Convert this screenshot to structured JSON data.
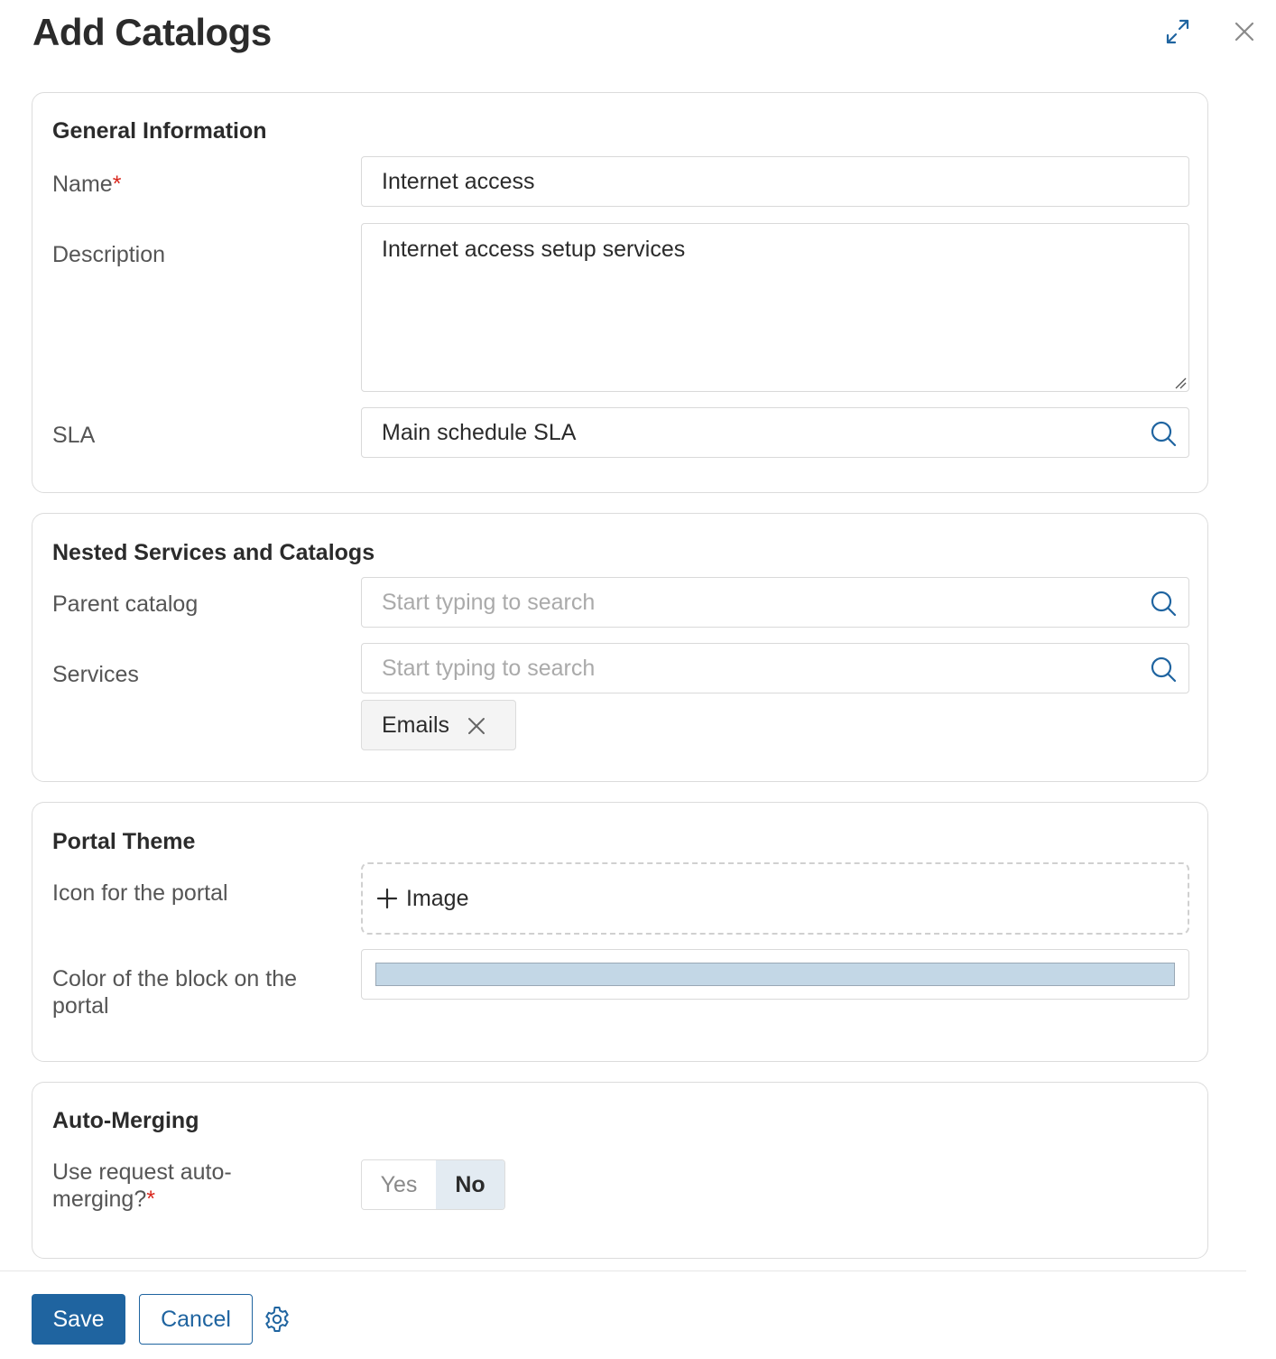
{
  "dialog": {
    "title": "Add Catalogs",
    "expand_icon": "expand-icon",
    "close_icon": "close-icon"
  },
  "general": {
    "title": "General Information",
    "name_label": "Name",
    "name_required": "*",
    "name_value": "Internet access",
    "description_label": "Description",
    "description_value": "Internet access setup services",
    "sla_label": "SLA",
    "sla_value": "Main schedule SLA"
  },
  "nested": {
    "title": "Nested Services and Catalogs",
    "parent_label": "Parent catalog",
    "parent_placeholder": "Start typing to search",
    "services_label": "Services",
    "services_placeholder": "Start typing to search",
    "selected_services": [
      "Emails"
    ]
  },
  "theme": {
    "title": "Portal Theme",
    "icon_label": "Icon for the portal",
    "add_image_label": "Image",
    "color_label": "Color of the block on the portal",
    "color_value": "#c3d7e6"
  },
  "merging": {
    "title": "Auto-Merging",
    "label": "Use request auto-merging?",
    "required": "*",
    "options": [
      "Yes",
      "No"
    ],
    "selected": "No"
  },
  "footer": {
    "save_label": "Save",
    "cancel_label": "Cancel",
    "settings_icon": "gear-icon"
  },
  "colors": {
    "accent": "#1f64a0",
    "required": "#d9261c",
    "toggle_selected_bg": "#e3ebf2"
  }
}
